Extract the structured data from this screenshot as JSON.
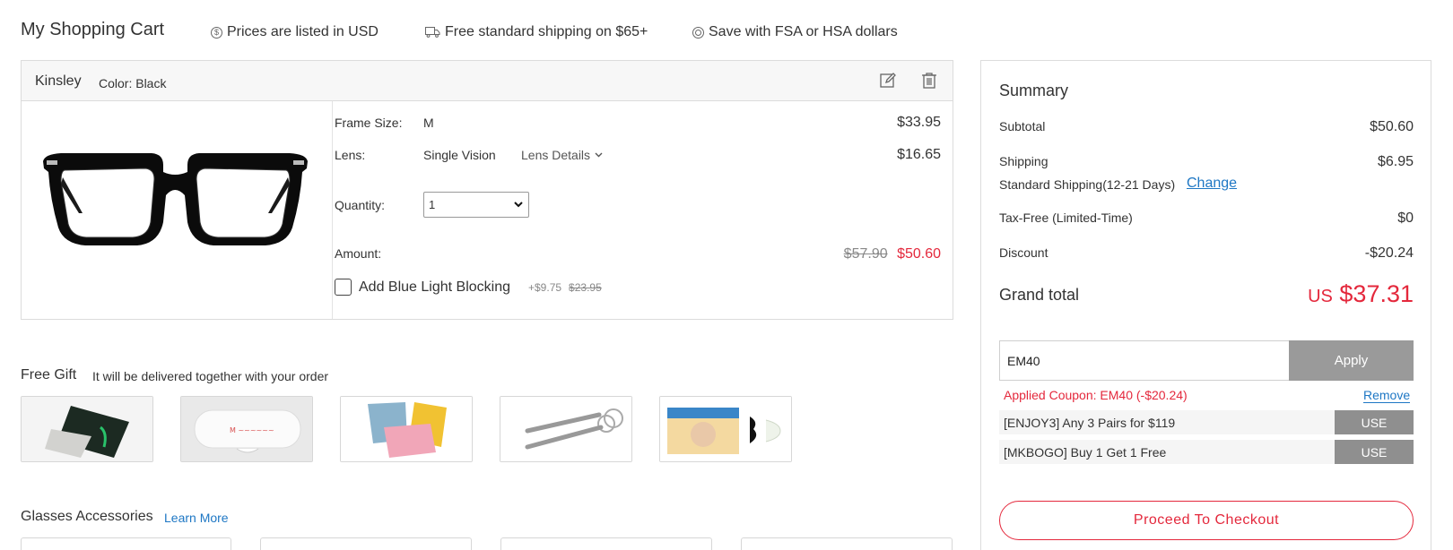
{
  "header": {
    "title": "My Shopping Cart",
    "info": [
      {
        "icon": "dollar-icon",
        "text": "Prices are listed in USD"
      },
      {
        "icon": "truck-icon",
        "text": "Free standard shipping on $65+"
      },
      {
        "icon": "circle-icon",
        "text": "Save with FSA or HSA dollars"
      }
    ]
  },
  "cart_item": {
    "name": "Kinsley",
    "color": "Color: Black",
    "frame_size_label": "Frame Size:",
    "frame_size_value": "M",
    "frame_price": "$33.95",
    "lens_label": "Lens:",
    "lens_value": "Single Vision",
    "lens_details": "Lens Details",
    "lens_price": "$16.65",
    "quantity_label": "Quantity:",
    "quantity_value": "1",
    "amount_label": "Amount:",
    "amount_original": "$57.90",
    "amount_final": "$50.60",
    "blue_light_label": "Add Blue Light Blocking",
    "blue_light_price": "+$9.75",
    "blue_light_original": "$23.95"
  },
  "free_gift": {
    "title": "Free Gift",
    "subtitle": "It will be delivered together with your order"
  },
  "accessories": {
    "title": "Glasses Accessories",
    "learn_more": "Learn More"
  },
  "summary": {
    "title": "Summary",
    "subtotal_label": "Subtotal",
    "subtotal_value": "$50.60",
    "shipping_label": "Shipping",
    "shipping_value": "$6.95",
    "shipping_method": "Standard Shipping(12-21 Days)",
    "change_link": "Change",
    "tax_label": "Tax-Free (Limited-Time)",
    "tax_value": "$0",
    "discount_label": "Discount",
    "discount_value": "-$20.24",
    "grand_label": "Grand total",
    "grand_currency": "US",
    "grand_value": "$37.31",
    "coupon_input_value": "EM40",
    "apply_label": "Apply",
    "applied_text": "Applied Coupon: EM40 (-$20.24)",
    "remove_label": "Remove",
    "coupons": [
      {
        "text": "[ENJOY3]  Any 3 Pairs for $119",
        "button": "USE"
      },
      {
        "text": "[MKBOGO]   Buy 1 Get 1 Free",
        "button": "USE"
      }
    ],
    "checkout_label": "Proceed To Checkout"
  },
  "colors": {
    "accent_red": "#e4283c",
    "link_blue": "#1e77c4",
    "button_gray": "#9a9a9a"
  }
}
